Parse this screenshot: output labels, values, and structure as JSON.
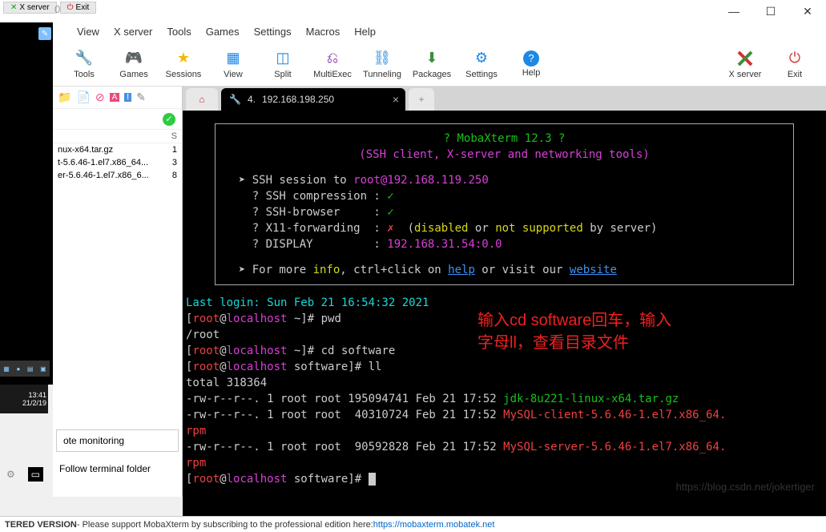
{
  "titlebar": {
    "num": "0"
  },
  "left_tabs": {
    "t1": "X server",
    "t2": "Exit"
  },
  "win": {
    "min": "—",
    "max": "☐",
    "close": "✕"
  },
  "menu": {
    "view": "View",
    "xserver": "X server",
    "tools": "Tools",
    "games": "Games",
    "settings": "Settings",
    "macros": "Macros",
    "help": "Help"
  },
  "toolbar": {
    "tools": "Tools",
    "games": "Games",
    "sessions": "Sessions",
    "view": "View",
    "split": "Split",
    "multiexec": "MultiExec",
    "tunneling": "Tunneling",
    "packages": "Packages",
    "settings": "Settings",
    "help": "Help",
    "xserver": "X server",
    "exit": "Exit"
  },
  "clock": {
    "time": "13:41",
    "date": "21/2/19"
  },
  "sidebar": {
    "col_s": "S",
    "files": [
      {
        "name": "nux-x64.tar.gz",
        "s": "1"
      },
      {
        "name": "t-5.6.46-1.el7.x86_64...",
        "s": "3"
      },
      {
        "name": "er-5.6.46-1.el7.x86_6...",
        "s": "8"
      }
    ],
    "remote_mon": "ote monitoring",
    "follow": "Follow terminal folder"
  },
  "tabs": {
    "home": "⌂",
    "active_num": "4.",
    "active": "192.168.198.250",
    "add": "+"
  },
  "term": {
    "title": "? MobaXterm 12.3 ?",
    "subtitle": "(SSH client, X-server and networking tools)",
    "ssh_to_pre": "SSH session to ",
    "ssh_user": "root",
    "ssh_host": "192.168.119.250",
    "ssh_comp": "? SSH compression : ",
    "ssh_brow": "? SSH-browser     : ",
    "x11_fwd": "? X11-forwarding  : ",
    "x11_tail": "  (",
    "x11_dis": "disabled",
    "x11_or1": " or ",
    "x11_ns": "not supported",
    "x11_by": " by server)",
    "display": "? DISPLAY         : ",
    "display_v": "192.168.31.54:0.0",
    "more_pre": "For more ",
    "more_info": "info",
    "more_mid": ", ctrl+click on ",
    "more_help": "help",
    "more_or": " or visit our ",
    "more_web": "website",
    "last_login": "Last login: Sun Feb 21 16:54:32 2021",
    "host": "localhost",
    "prompt_home": " ~]# ",
    "prompt_sw": " software]# ",
    "cmd_pwd": "pwd",
    "out_root": "/root",
    "cmd_cd": "cd software",
    "cmd_ll": "ll",
    "total": "total 318364",
    "ls1_a": "-rw-r--r--. 1 root root 195094741 Feb 21 17:52 ",
    "ls1_b": "jdk-8u221-linux-x64.tar.gz",
    "ls2_a": "-rw-r--r--. 1 root root  40310724 Feb 21 17:52 ",
    "ls2_b": "MySQL-client-5.6.46-1.el7.x86_64.",
    "ls3_a": "-rw-r--r--. 1 root root  90592828 Feb 21 17:52 ",
    "ls3_b": "MySQL-server-5.6.46-1.el7.x86_64.",
    "rpm": "rpm",
    "root_lb": "root"
  },
  "annotation": {
    "l1": "输入cd software回车，输入",
    "l2": "字母ll，查看目录文件"
  },
  "status": {
    "ver": "TERED VERSION",
    "msg": "  -  Please support MobaXterm by subscribing to the professional edition here:  ",
    "url": "https://mobaxterm.mobatek.net"
  },
  "watermark": "https://blog.csdn.net/jokertiger"
}
